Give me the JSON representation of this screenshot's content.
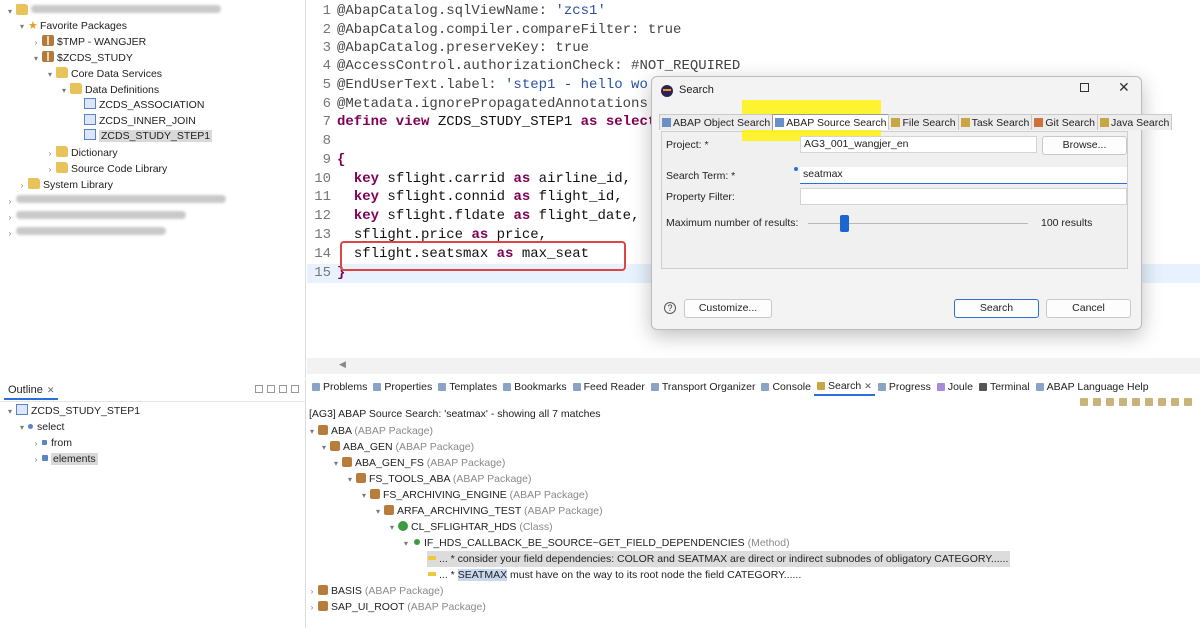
{
  "explorer": {
    "favorite_packages": "Favorite Packages",
    "tmp_package": "$TMP - WANGJER",
    "zcds_study": "$ZCDS_STUDY",
    "core_data_services": "Core Data Services",
    "data_definitions": "Data Definitions",
    "def_association": "ZCDS_ASSOCIATION",
    "def_inner_join": "ZCDS_INNER_JOIN",
    "def_study_step1": "ZCDS_STUDY_STEP1",
    "dictionary": "Dictionary",
    "source_code_library": "Source Code Library",
    "system_library": "System Library"
  },
  "editor": {
    "line_numbers": [
      "1",
      "2",
      "3",
      "4",
      "5",
      "6",
      "7",
      "8",
      "9",
      "10",
      "11",
      "12",
      "13",
      "14",
      "15"
    ],
    "l1_anno": "@AbapCatalog.sqlViewName: ",
    "l1_str": "'zcs1'",
    "l2_anno": "@AbapCatalog.compiler.compareFilter: true",
    "l3_anno": "@AbapCatalog.preserveKey: true",
    "l4_anno": "@AccessControl.authorizationCheck: #NOT_REQUIRED",
    "l5_anno": "@EndUserText.label: ",
    "l5_str": "'step1 - hello wo",
    "l6_anno": "@Metadata.ignorePropagatedAnnotations",
    "l7_kw1": "define view",
    "l7_name": " ZCDS_STUDY_STEP1 ",
    "l7_kw2": "as select",
    "l9_brace": "{",
    "l10_kw": "key",
    "l10_field": " sflight.carrid ",
    "l10_as": "as",
    "l10_alias": " airline_id,",
    "l11_kw": "key",
    "l11_field": " sflight.connid ",
    "l11_as": "as",
    "l11_alias": " flight_id,",
    "l12_kw": "key",
    "l12_field": " sflight.fldate ",
    "l12_as": "as",
    "l12_alias": " flight_date,",
    "l13_field": "sflight.price ",
    "l13_as": "as",
    "l13_alias": " price,",
    "l14_field": "sflight.seatsmax ",
    "l14_as": "as",
    "l14_alias": " max_seat",
    "l15_brace": "}"
  },
  "outline": {
    "tab_label": "Outline",
    "root": "ZCDS_STUDY_STEP1",
    "select": "select",
    "from": "from",
    "elements": "elements"
  },
  "bottom_tabs": [
    "Problems",
    "Properties",
    "Templates",
    "Bookmarks",
    "Feed Reader",
    "Transport Organizer",
    "Console",
    "Search",
    "Progress",
    "Joule",
    "Terminal",
    "ABAP Language Help"
  ],
  "search_results": {
    "header": "[AG3] ABAP Source Search: 'seatmax' - showing all 7 matches",
    "aba": "ABA",
    "aba_gen": "ABA_GEN",
    "aba_gen_fs": "ABA_GEN_FS",
    "fs_tools_aba": "FS_TOOLS_ABA",
    "fs_archiving_engine": "FS_ARCHIVING_ENGINE",
    "arfa_archiving_test": "ARFA_ARCHIVING_TEST",
    "cl_sflightar_hds": "CL_SFLIGHTAR_HDS",
    "method": "IF_HDS_CALLBACK_BE_SOURCE~GET_FIELD_DEPENDENCIES",
    "pkg_type": "(ABAP Package)",
    "class_type": "(Class)",
    "method_type": "(Method)",
    "match1": "... * consider your field dependencies: COLOR and SEATMAX are direct or indirect subnodes of obligatory CATEGORY......",
    "match2_pre": "... * ",
    "match2_hl": "SEATMAX",
    "match2_post": " must have on the way to its root node the field CATEGORY......",
    "basis": "BASIS",
    "sap_ui_root": "SAP_UI_ROOT"
  },
  "dialog": {
    "title": "Search",
    "tabs": [
      "ABAP Object Search",
      "ABAP Source Search",
      "File Search",
      "Task Search",
      "Git Search",
      "Java Search"
    ],
    "project_label": "Project: *",
    "project_value": "AG3_001_wangjer_en",
    "browse_button": "Browse...",
    "search_term_label": "Search Term: *",
    "search_term_value": "seatmax",
    "property_filter_label": "Property Filter:",
    "max_results_label": "Maximum number of results:",
    "max_results_value": "100 results",
    "customize_button": "Customize...",
    "search_button": "Search",
    "cancel_button": "Cancel"
  }
}
